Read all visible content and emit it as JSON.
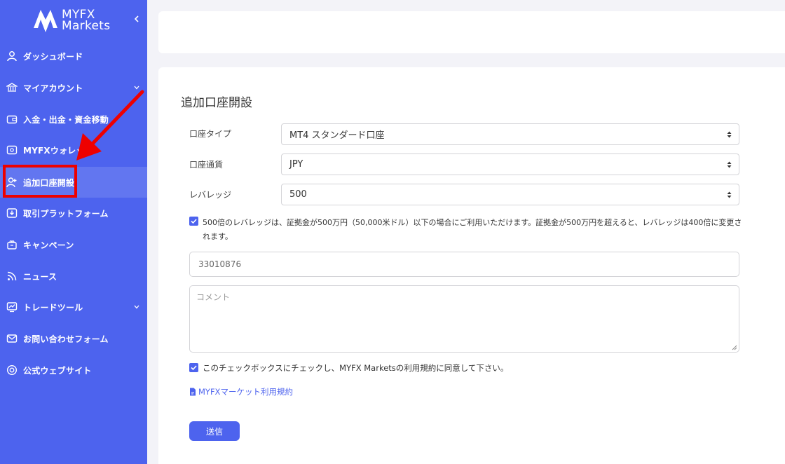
{
  "brand": {
    "line1": "MYFX",
    "line2": "Markets"
  },
  "sidebar": {
    "items": [
      {
        "label": "ダッシュボード",
        "icon": "user-icon"
      },
      {
        "label": "マイアカウント",
        "icon": "bank-icon"
      },
      {
        "label": "入金・出金・資金移動",
        "icon": "wallet-icon"
      },
      {
        "label": "MYFXウォレット",
        "icon": "safe-icon"
      },
      {
        "label": "追加口座開設",
        "icon": "user-add-icon"
      },
      {
        "label": "取引プラットフォーム",
        "icon": "download-icon"
      },
      {
        "label": "キャンペーン",
        "icon": "gift-icon"
      },
      {
        "label": "ニュース",
        "icon": "rss-icon"
      },
      {
        "label": "トレードツール",
        "icon": "chart-icon"
      },
      {
        "label": "お問い合わせフォーム",
        "icon": "mail-icon"
      },
      {
        "label": "公式ウェブサイト",
        "icon": "globe-icon"
      }
    ]
  },
  "page": {
    "title": "追加口座開設"
  },
  "form": {
    "account_type_label": "口座タイプ",
    "account_type_value": "MT4 スタンダード口座",
    "currency_label": "口座通貨",
    "currency_value": "JPY",
    "leverage_label": "レバレッジ",
    "leverage_value": "500",
    "leverage_note": "500倍のレバレッジは、証拠金が500万円（50,000米ドル）以下の場合にご利用いただけます。証拠金が500万円を超えると、レバレッジは400倍に変更されます。",
    "account_number": "33010876",
    "comment_placeholder": "コメント",
    "agree_text": "このチェックボックスにチェックし、MYFX Marketsの利用規約に同意して下さい。",
    "terms_link": "MYFXマーケット利用規約",
    "submit_label": "送信"
  },
  "colors": {
    "primary": "#4d63ee",
    "highlight": "#ee0000"
  }
}
